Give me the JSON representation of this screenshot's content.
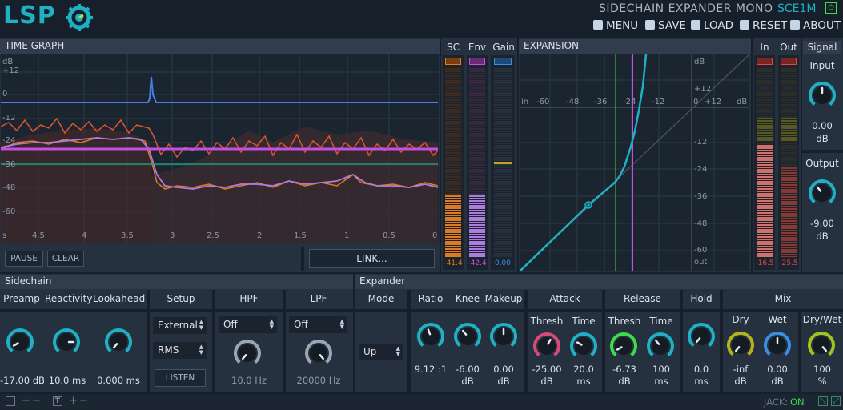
{
  "header": {
    "logo": "LSP",
    "plugin_title": "SIDECHAIN EXPANDER MONO",
    "device_code": "SCE1M",
    "menu": {
      "menu": "MENU",
      "save": "SAVE",
      "load": "LOAD",
      "reset": "RESET",
      "about": "ABOUT"
    }
  },
  "time_graph": {
    "title": "TIME GRAPH",
    "y_labels": [
      "dB",
      "+12",
      "0",
      "-12",
      "-24",
      "-36",
      "-48",
      "-60"
    ],
    "x_labels": [
      "s",
      "4.5",
      "4",
      "3.5",
      "3",
      "2.5",
      "2",
      "1.5",
      "1",
      "0.5",
      "0"
    ],
    "pause": "PAUSE",
    "clear": "CLEAR",
    "link": "LINK..."
  },
  "meters_left": {
    "sc": {
      "label": "SC",
      "value": "-41.4",
      "color": "#e07a1c"
    },
    "env": {
      "label": "Env",
      "value": "-42.4",
      "color": "#c64ee0"
    },
    "gain": {
      "label": "Gain",
      "value": "0.00",
      "color": "#3a8ee0"
    }
  },
  "expansion": {
    "title": "EXPANSION",
    "top_labels": [
      "in",
      "-60",
      "-48",
      "-36",
      "-24",
      "-12",
      "0",
      "+12",
      "dB"
    ],
    "right_labels": [
      "dB",
      "+12",
      "0",
      "-12",
      "-24",
      "-36",
      "-48",
      "-60",
      "out"
    ]
  },
  "meters_right": {
    "in": {
      "label": "In",
      "value": "-16.5"
    },
    "out": {
      "label": "Out",
      "value": "-25.5"
    }
  },
  "signal": {
    "title": "Signal",
    "input_label": "Input",
    "input_value": "0.00",
    "input_unit": "dB",
    "output_label": "Output",
    "output_value": "-9.00",
    "output_unit": "dB"
  },
  "sidechain": {
    "title": "Sidechain",
    "preamp": {
      "label": "Preamp",
      "value": "-17.00 dB"
    },
    "reactivity": {
      "label": "Reactivity",
      "value": "10.0 ms"
    },
    "lookahead": {
      "label": "Lookahead",
      "value": "0.000 ms"
    },
    "setup": {
      "label": "Setup",
      "source": "External",
      "mode": "RMS",
      "listen": "LISTEN"
    },
    "hpf": {
      "label": "HPF",
      "mode": "Off",
      "value": "10.0 Hz"
    },
    "lpf": {
      "label": "LPF",
      "mode": "Off",
      "value": "20000 Hz"
    }
  },
  "expander": {
    "title": "Expander",
    "mode": {
      "label": "Mode",
      "value": "Up"
    },
    "ratio": {
      "label": "Ratio",
      "value": "9.12 :1"
    },
    "knee": {
      "label": "Knee",
      "value": "-6.00",
      "unit": "dB"
    },
    "makeup": {
      "label": "Makeup",
      "value": "0.00",
      "unit": "dB"
    },
    "attack": {
      "label": "Attack",
      "thresh_label": "Thresh",
      "thresh_value": "-25.00",
      "thresh_unit": "dB",
      "time_label": "Time",
      "time_value": "20.0",
      "time_unit": "ms"
    },
    "release": {
      "label": "Release",
      "thresh_label": "Thresh",
      "thresh_value": "-6.73",
      "thresh_unit": "dB",
      "time_label": "Time",
      "time_value": "100",
      "time_unit": "ms"
    },
    "hold": {
      "label": "Hold",
      "value": "0.0",
      "unit": "ms"
    },
    "mix": {
      "label": "Mix",
      "dry_label": "Dry",
      "dry_value": "-inf",
      "dry_unit": "dB",
      "wet_label": "Wet",
      "wet_value": "0.00",
      "wet_unit": "dB"
    },
    "drywet": {
      "label": "Dry/Wet",
      "value": "100",
      "unit": "%"
    }
  },
  "status": {
    "jack_label": "JACK:",
    "jack_state": "ON"
  },
  "colors": {
    "teal": "#1fb0c4",
    "panel": "#25313f",
    "header": "#313d4c",
    "green": "#3ddc4a",
    "pink": "#d64a7a",
    "blue_knob": "#3a8ee0",
    "olive": "#b5b21e",
    "lime": "#a3c51b"
  }
}
